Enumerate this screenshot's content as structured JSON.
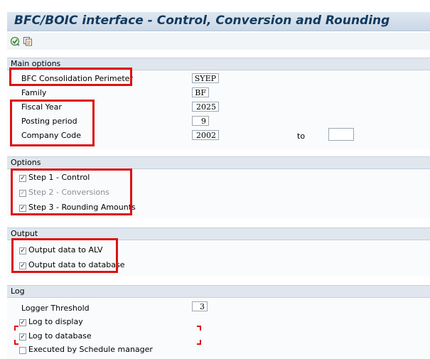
{
  "title": "BFC/BOIC interface - Control, Conversion and Rounding",
  "toolbar": {
    "icons": [
      "execute-icon",
      "variants-icon"
    ]
  },
  "main_options": {
    "header": "Main options",
    "perimeter_label": "BFC Consolidation Perimeter",
    "perimeter_value": "SYEP",
    "family_label": "Family",
    "family_value": "BF",
    "fiscal_year_label": "Fiscal Year",
    "fiscal_year_value": "2025",
    "posting_period_label": "Posting period",
    "posting_period_value": "9",
    "company_code_label": "Company Code",
    "company_code_value": "2002",
    "to_label": "to",
    "to_value": ""
  },
  "options": {
    "header": "Options",
    "step1": "Step 1 - Control",
    "step2": "Step 2 - Conversions",
    "step3": "Step 3 - Rounding Amounts"
  },
  "output": {
    "header": "Output",
    "alv": "Output data to ALV",
    "database": "Output data to database"
  },
  "log": {
    "header": "Log",
    "threshold_label": "Logger Threshold",
    "threshold_value": "3",
    "display": "Log to display",
    "database": "Log to database",
    "schedule": "Executed by Schedule manager"
  },
  "colors": {
    "highlight": "#dd1111",
    "title": "#123a5e"
  }
}
